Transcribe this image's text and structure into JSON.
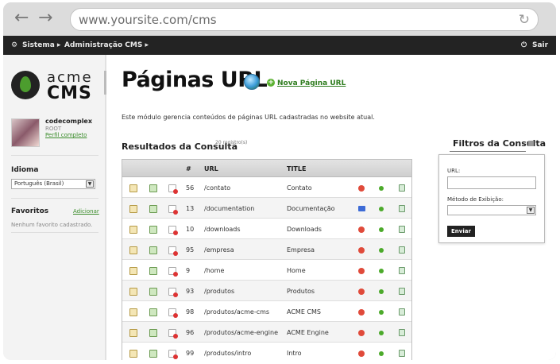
{
  "browser": {
    "url": "www.yoursite.com/cms"
  },
  "topmenu": {
    "items": [
      "Sistema",
      "Administração CMS"
    ],
    "logout": "Sair"
  },
  "sidebar": {
    "logo_acme": "acme",
    "logo_cms": "CMS",
    "user": {
      "name": "codecomplex",
      "role": "ROOT",
      "profile_link": "Perfil completo"
    },
    "language": {
      "heading": "Idioma",
      "selected": "Português (Brasil)"
    },
    "favorites": {
      "heading": "Favoritos",
      "add_link": "Adicionar",
      "empty_text": "Nenhum favorito cadastrado."
    }
  },
  "main": {
    "title": "Páginas URL",
    "new_page_link": "Nova Página URL",
    "description": "Este módulo gerencia conteúdos de páginas URL cadastradas no website atual.",
    "results_heading": "Resultados da Consulta",
    "results_count": "20 registro(s)",
    "table": {
      "columns": [
        "#",
        "URL",
        "TITLE"
      ],
      "rows": [
        {
          "id": "56",
          "url": "/contato",
          "title": "Contato",
          "flag": "red"
        },
        {
          "id": "13",
          "url": "/documentation",
          "title": "Documentação",
          "flag": "blue"
        },
        {
          "id": "10",
          "url": "/downloads",
          "title": "Downloads",
          "flag": "red"
        },
        {
          "id": "95",
          "url": "/empresa",
          "title": "Empresa",
          "flag": "red"
        },
        {
          "id": "9",
          "url": "/home",
          "title": "Home",
          "flag": "red"
        },
        {
          "id": "93",
          "url": "/produtos",
          "title": "Produtos",
          "flag": "red"
        },
        {
          "id": "98",
          "url": "/produtos/acme-cms",
          "title": "ACME CMS",
          "flag": "red"
        },
        {
          "id": "96",
          "url": "/produtos/acme-engine",
          "title": "ACME Engine",
          "flag": "red"
        },
        {
          "id": "99",
          "url": "/produtos/intro",
          "title": "Intro",
          "flag": "red"
        }
      ]
    }
  },
  "filters": {
    "heading": "Filtros da Consulta",
    "url_label": "URL:",
    "method_label": "Método de Exibição:",
    "submit": "Enviar"
  },
  "colors": {
    "accent_green": "#3a8c2a",
    "topbar": "#232323"
  }
}
